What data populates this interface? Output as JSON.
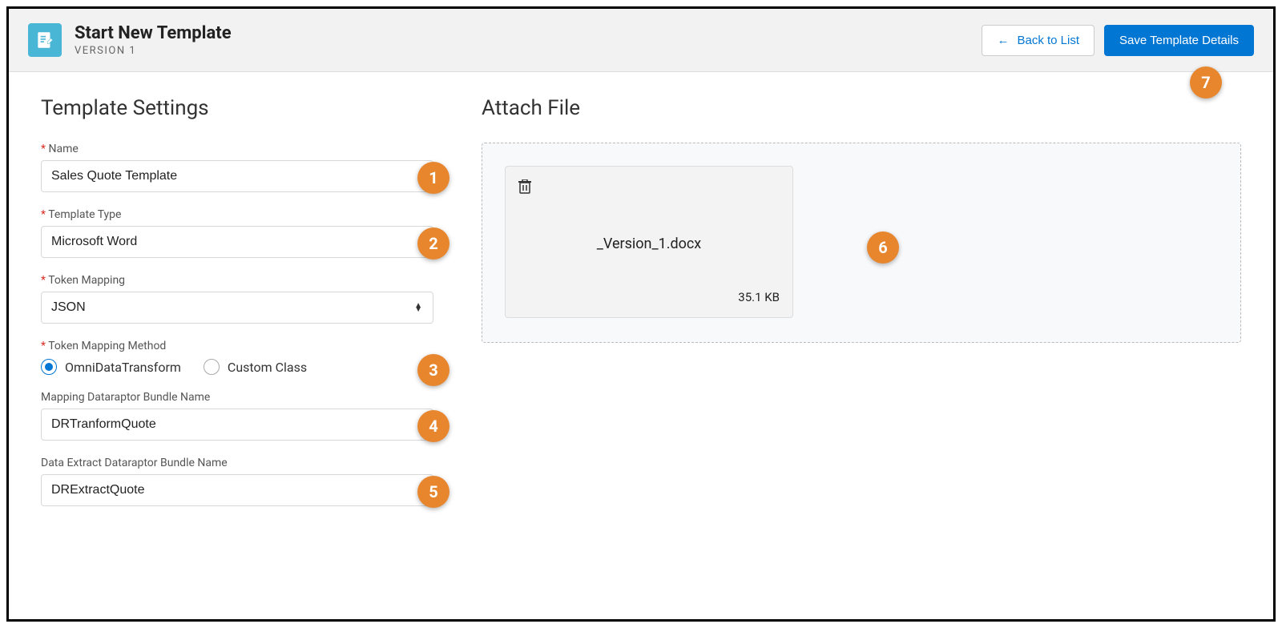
{
  "header": {
    "title": "Start New Template",
    "subtitle": "VERSION 1",
    "back_button": "Back to List",
    "save_button": "Save Template Details"
  },
  "settings": {
    "section_title": "Template Settings",
    "name_label": "Name",
    "name_value": "Sales Quote Template",
    "type_label": "Template Type",
    "type_value": "Microsoft Word",
    "token_mapping_label": "Token Mapping",
    "token_mapping_value": "JSON",
    "token_method_label": "Token Mapping Method",
    "radio_omni": "OmniDataTransform",
    "radio_custom": "Custom Class",
    "mapping_bundle_label": "Mapping Dataraptor Bundle Name",
    "mapping_bundle_value": "DRTranformQuote",
    "extract_bundle_label": "Data Extract Dataraptor Bundle Name",
    "extract_bundle_value": "DRExtractQuote"
  },
  "attach": {
    "section_title": "Attach File",
    "file_name": "_Version_1.docx",
    "file_size": "35.1 KB"
  },
  "callouts": {
    "c1": "1",
    "c2": "2",
    "c3": "3",
    "c4": "4",
    "c5": "5",
    "c6": "6",
    "c7": "7"
  }
}
